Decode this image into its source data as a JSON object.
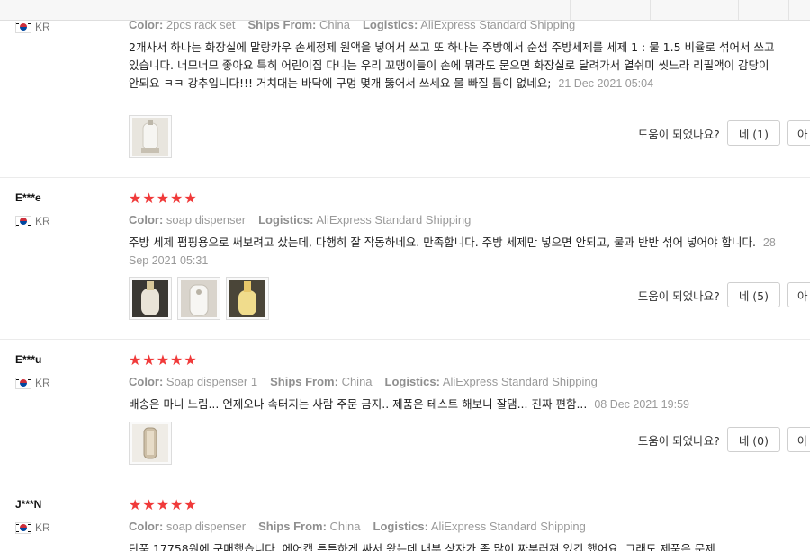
{
  "accent": "#f03a3a",
  "helpful_label": "도움이 되었나요?",
  "labels": {
    "color": "Color:",
    "ships_from": "Ships From:",
    "logistics": "Logistics:"
  },
  "reviews": [
    {
      "user": "",
      "country": "KR",
      "color": "2pcs rack set",
      "ships_from": "China",
      "logistics": "AliExpress Standard Shipping",
      "text": "2개사서 하나는 화장실에 말랑카우 손세정제 원액을 넣어서 쓰고 또 하나는 주방에서 순샘 주방세제를 세제 1 : 물 1.5 비율로 섞어서 쓰고 있습니다. 너므너므 좋아요 특히 어린이집 다니는 우리 꼬맹이들이 손에 뭐라도 묻으면 화장실로 달려가서 열쉬미 씻느라 리필액이 감당이 안되요 ㅋㅋ 강추입니다!!! 거치대는 바닥에 구멍 몇개 뚫어서 쓰세요 물 빠질 틈이 없네요;",
      "date": "21 Dec 2021 05:04",
      "yes_label": "네 (1)",
      "no_label": "아"
    },
    {
      "user": "E***e",
      "country": "KR",
      "stars": "★★★★★",
      "color": "soap dispenser",
      "logistics": "AliExpress Standard Shipping",
      "text": "주방 세제 펌핑용으로 써보려고 샀는데, 다행히 잘 작동하네요. 만족합니다. 주방 세제만 넣으면 안되고, 물과 반반 섞어 넣어야 합니다.",
      "date": "28 Sep 2021 05:31",
      "yes_label": "네 (5)",
      "no_label": "아"
    },
    {
      "user": "E***u",
      "country": "KR",
      "stars": "★★★★★",
      "color": "Soap dispenser 1",
      "ships_from": "China",
      "logistics": "AliExpress Standard Shipping",
      "text": "배송은 마니 느림... 언제오나 속터지는 사람 주문 금지.. 제품은 테스트 해보니 잘댐... 진짜 편함...",
      "date": "08 Dec 2021 19:59",
      "yes_label": "네 (0)",
      "no_label": "아"
    },
    {
      "user": "J***N",
      "country": "KR",
      "stars": "★★★★★",
      "color": "soap dispenser",
      "ships_from": "China",
      "logistics": "AliExpress Standard Shipping",
      "text": "단품 17758원에 구매했습니다. 에어캡 튼튼하게 싸서 왔는데 내부 상자가 좀 많이 짜부러져 있긴 했어요. 그래도 제품은 문제"
    }
  ]
}
